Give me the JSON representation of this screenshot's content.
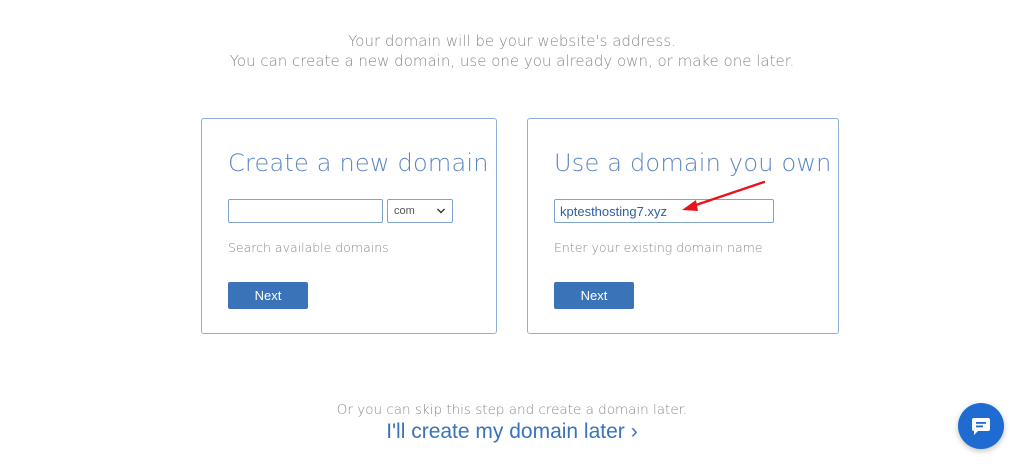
{
  "intro": {
    "line1": "Your domain will be your website's address.",
    "line2": "You can create a new domain, use one you already own, or make one later."
  },
  "new_domain": {
    "title": "Create a new domain",
    "input_value": "",
    "tld_selected": "com",
    "hint": "Search available domains",
    "next_label": "Next"
  },
  "own_domain": {
    "title": "Use a domain you own",
    "input_value": "kptesthosting7.xyz",
    "hint": "Enter your existing domain name",
    "next_label": "Next"
  },
  "skip": {
    "text": "Or you can skip this step and create a domain later.",
    "link_label": "I'll create my domain later",
    "link_chevron": "›"
  },
  "icons": {
    "tld_chevron": "chevron-down-icon",
    "chat": "chat-bubble-icon",
    "arrow": "red-arrow-annotation"
  },
  "colors": {
    "accent": "#3a73b8",
    "title": "#5b86c2",
    "border": "#8fb0d6",
    "muted_text": "#8a8a8a",
    "annotation": "#e8131b",
    "chat": "#1f6bd1"
  }
}
